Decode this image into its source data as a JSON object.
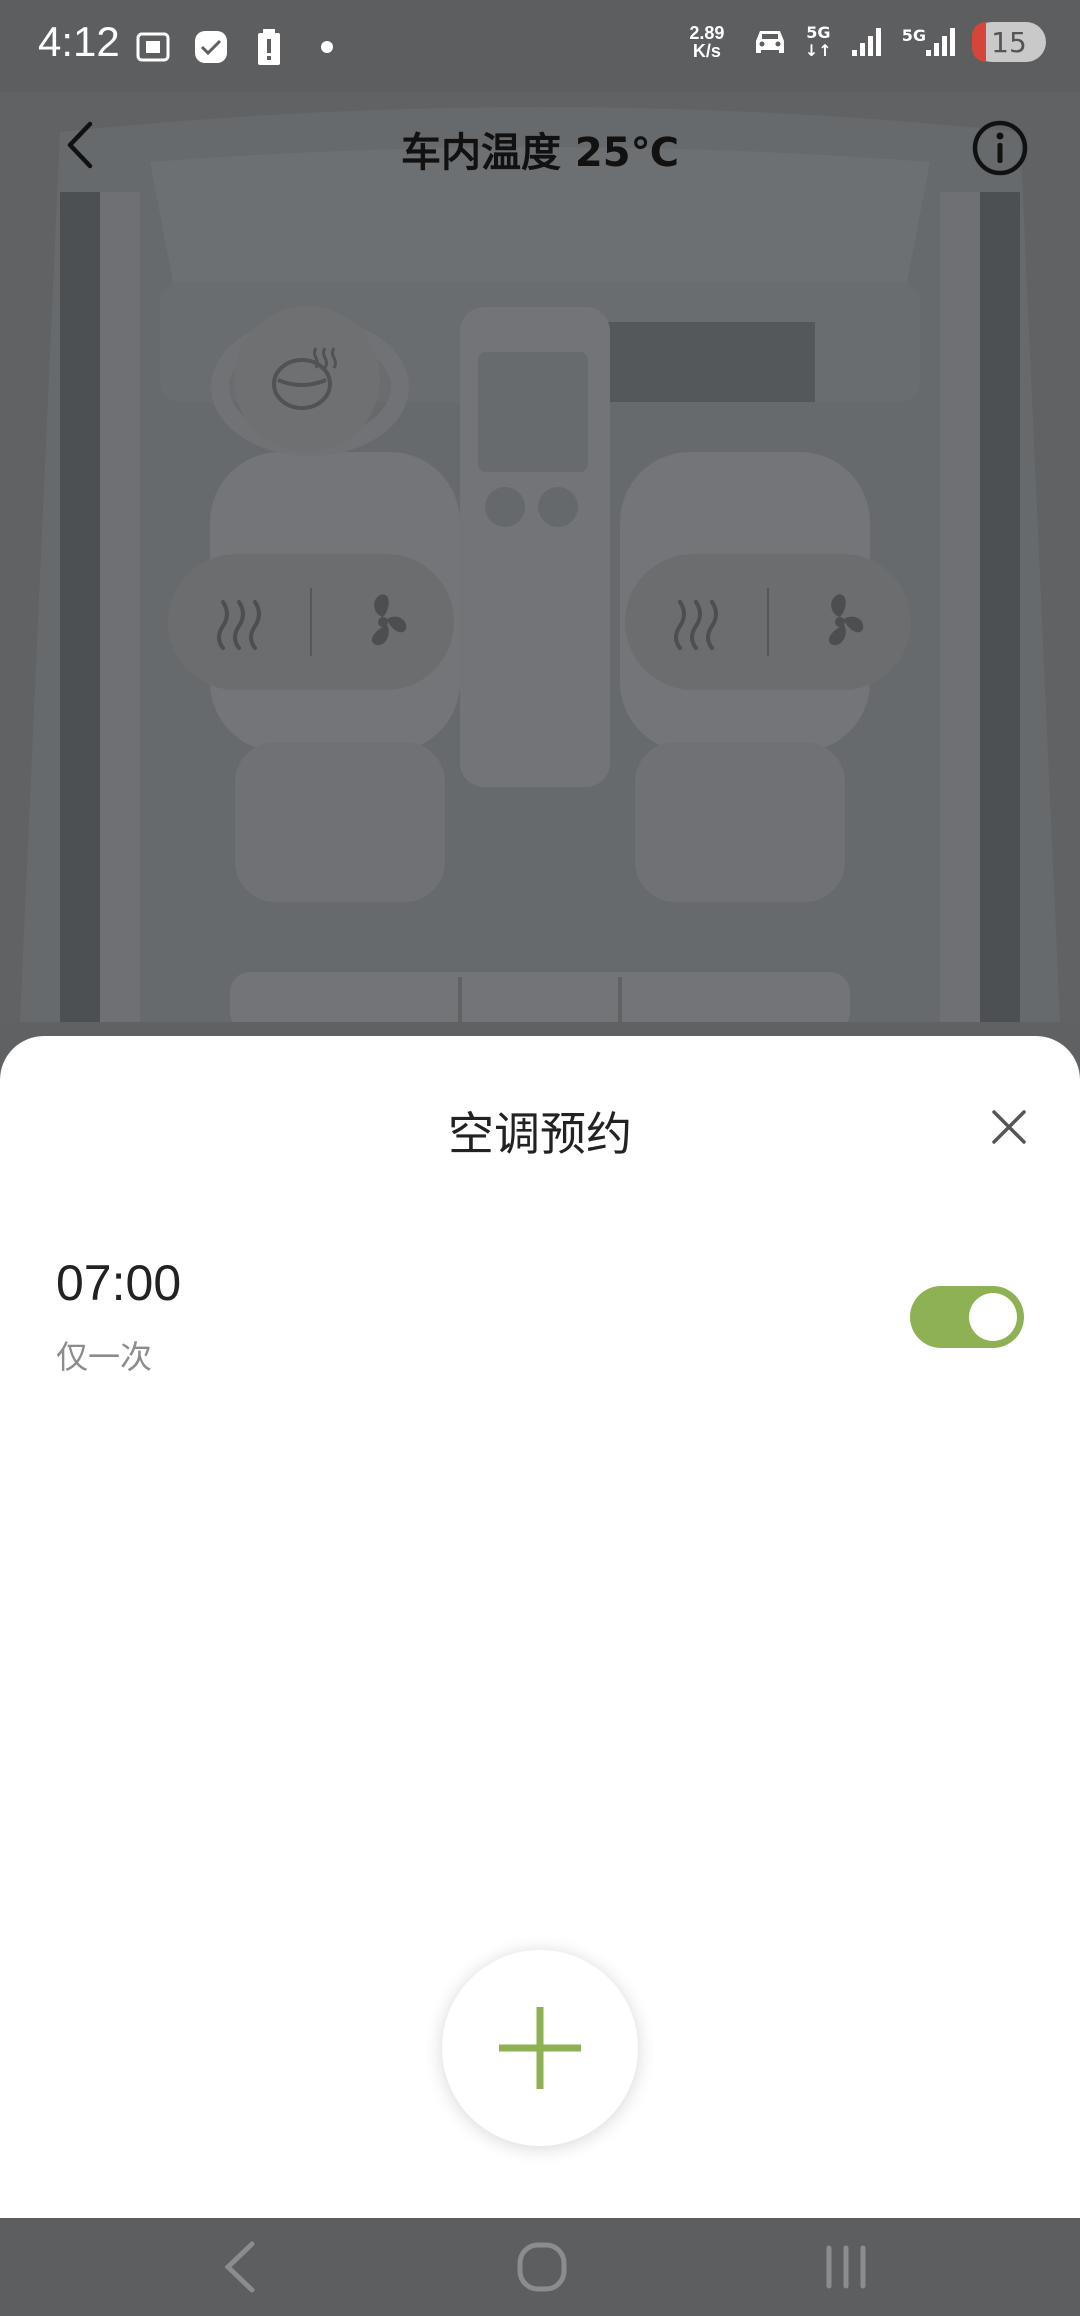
{
  "status_bar": {
    "time": "4:12",
    "net_speed_value": "2.89",
    "net_speed_unit": "K/s",
    "network_1": "5G",
    "network_2": "5G",
    "battery": "15",
    "icons_left": [
      "screenshot-icon",
      "check-app-icon",
      "battery-alert-icon",
      "dot-icon"
    ],
    "icons_right": [
      "car-icon",
      "signal-5g-icon",
      "signal-bars-icon",
      "signal-bars-5g-icon"
    ]
  },
  "header": {
    "title": "车内温度 25℃"
  },
  "controls": {
    "steering_wheel_heat": "steering-wheel-heat-icon",
    "left_seat": [
      "seat-heat-icon",
      "seat-fan-icon"
    ],
    "right_seat": [
      "seat-heat-icon",
      "seat-fan-icon"
    ]
  },
  "sheet": {
    "title": "空调预约",
    "schedule": {
      "time": "07:00",
      "repeat": "仅一次",
      "enabled": true
    }
  },
  "colors": {
    "accent": "#8db153",
    "overlay": "#5f6163",
    "sheet_bg": "#ffffff"
  }
}
